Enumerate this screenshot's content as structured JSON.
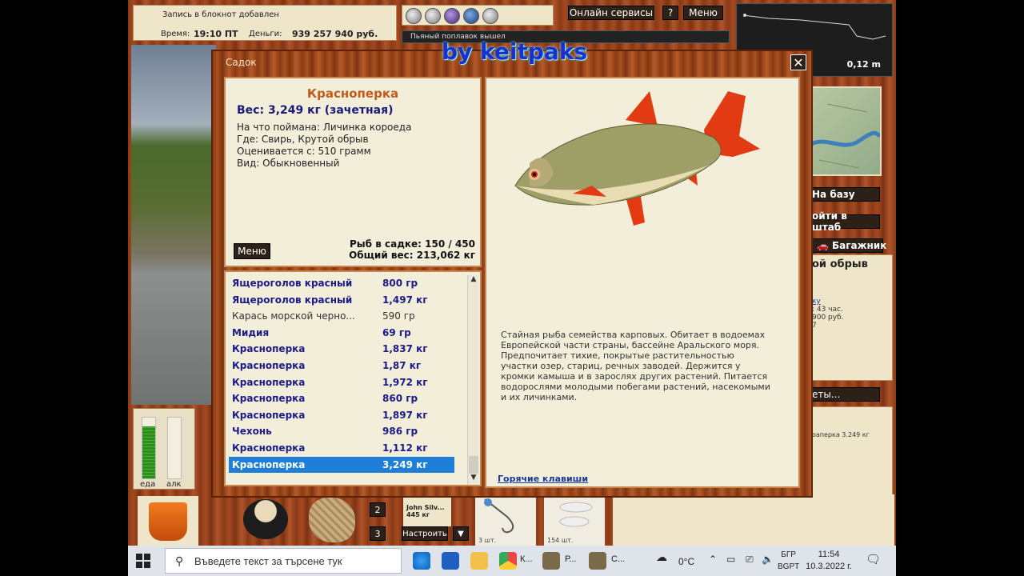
{
  "hud": {
    "notice": "Запись в блокнот добавлен",
    "time_label": "Время:",
    "time_value": "19:10 ПТ",
    "money_label": "Деньги:",
    "money_value": "939 257 940 руб.",
    "online_services": "Онлайн сервисы",
    "help": "?",
    "menu": "Меню",
    "message": "Пьяный поплавок вышел",
    "depth": "0,12 m"
  },
  "watermark": "by keitpaks",
  "right_panel": {
    "to_base": "На базу",
    "to_hq": "ойти в штаб",
    "trunk": "Багажник",
    "location_fragment": "ой обрыв",
    "link_fragment": "ку",
    "hours_fragment": ": 43 час.",
    "money_fragment": "900 руб.",
    "seven": "7",
    "ety": "еты...",
    "catch_fragment": "оаперка 3.249 кг"
  },
  "gauges": {
    "food_label": "еда",
    "alc_label": "алк",
    "food_level": 0.85,
    "alc_level": 0.0
  },
  "bottom": {
    "slot2": "2",
    "slot3": "3",
    "angler_name": "John Silv...",
    "angler_weight": "445 кг",
    "configure": "Настроить",
    "dropdown": "▼",
    "count1": "3 шт.",
    "count2": "154 шт."
  },
  "dialog": {
    "title": "Садок",
    "close": "✕",
    "fish_name": "Красноперка",
    "fish_weight": "Вес: 3,249 кг (зачетная)",
    "details": [
      "На что поймана: Личинка короеда",
      "Где: Свирь, Крутой обрыв",
      "Оценивается с: 510 грамм",
      "Вид: Обыкновенный"
    ],
    "menu": "Меню",
    "in_keepnet": "Рыб в садке: 150 / 450",
    "total_weight": "Общий вес: 213,062 кг",
    "catch_list": [
      {
        "name": "Ящероголов красный",
        "weight": "800 гр",
        "style": "trophy"
      },
      {
        "name": "Ящероголов красный",
        "weight": "1,497 кг",
        "style": "trophy"
      },
      {
        "name": "Карась морской черно...",
        "weight": "590 гр",
        "style": "plain"
      },
      {
        "name": "Мидия",
        "weight": "69 гр",
        "style": "trophy"
      },
      {
        "name": "Красноперка",
        "weight": "1,837 кг",
        "style": "trophy"
      },
      {
        "name": "Красноперка",
        "weight": "1,87 кг",
        "style": "trophy"
      },
      {
        "name": "Красноперка",
        "weight": "1,972 кг",
        "style": "trophy"
      },
      {
        "name": "Красноперка",
        "weight": "860 гр",
        "style": "trophy"
      },
      {
        "name": "Красноперка",
        "weight": "1,897 кг",
        "style": "trophy"
      },
      {
        "name": "Чехонь",
        "weight": "986 гр",
        "style": "trophy"
      },
      {
        "name": "Красноперка",
        "weight": "1,112 кг",
        "style": "trophy"
      },
      {
        "name": "Красноперка",
        "weight": "3,249 кг",
        "style": "selected"
      }
    ],
    "description": "Стайная рыба семейства карповых. Обитает в водоемах Европейской части страны, бассейне Аральского моря. Предпочитает тихие, покрытые растительностью участки озер, стариц, речных заводей. Держится у кромки камыша и в зарослях других растений. Питается водорослями молодыми побегами растений, насекомыми и их личинками.",
    "hotkeys": "Горячие клавиши"
  },
  "taskbar": {
    "search_placeholder": "Въведете текст за търсене тук",
    "app1": "К...",
    "app2": "Р...",
    "app3": "С...",
    "temperature": "0°C",
    "lang1": "БГР",
    "lang2": "BGPT",
    "time": "11:54",
    "date": "10.3.2022 г."
  },
  "colors": {
    "wood": "#8c3b17",
    "cream": "#f3eed9",
    "fish_name": "#c45a1a",
    "selection": "#1f7fd8"
  }
}
